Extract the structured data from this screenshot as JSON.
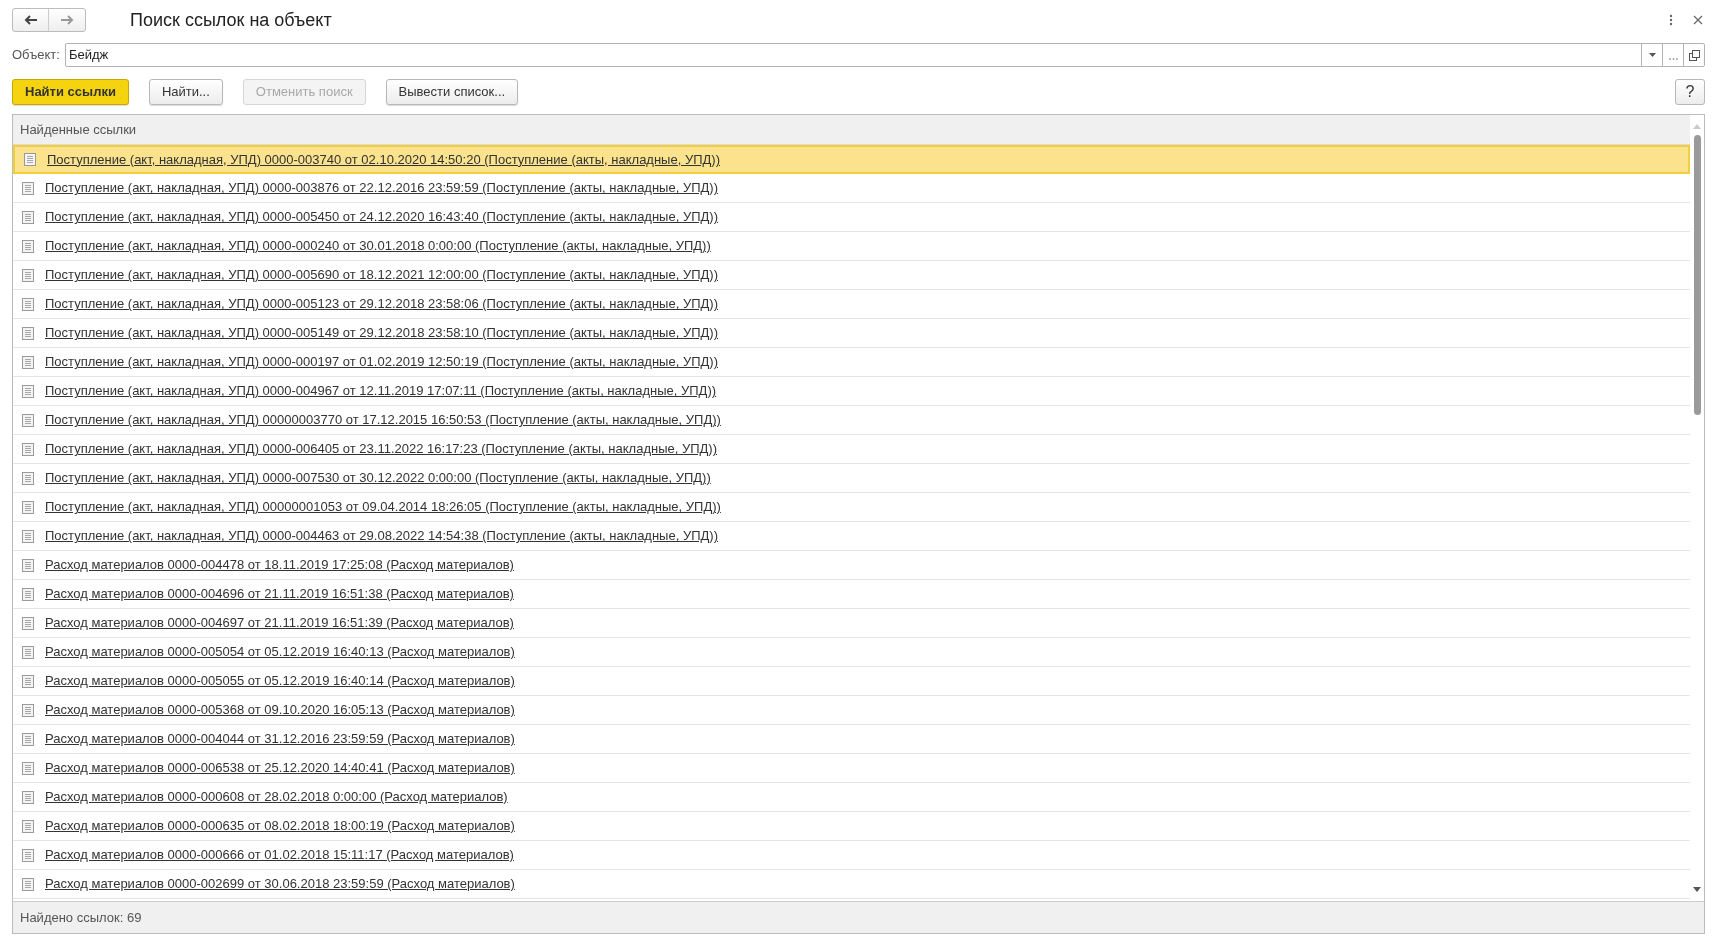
{
  "window": {
    "title": "Поиск ссылок на объект"
  },
  "object_field": {
    "label": "Объект:",
    "value": "Бейдж"
  },
  "buttons": [
    {
      "label": "Найти ссылки",
      "kind": "primary",
      "disabled": false
    },
    {
      "label": "Найти...",
      "kind": "default",
      "disabled": false
    },
    {
      "label": "Отменить поиск",
      "kind": "default",
      "disabled": true
    },
    {
      "label": "Вывести список...",
      "kind": "default",
      "disabled": false
    }
  ],
  "help_button": {
    "label": "?"
  },
  "table": {
    "header": "Найденные ссылки",
    "rows": [
      {
        "text": "Поступление (акт, накладная, УПД) 0000-003740 от 02.10.2020 14:50:20 (Поступление (акты, накладные, УПД))",
        "selected": true
      },
      {
        "text": "Поступление (акт, накладная, УПД) 0000-003876 от 22.12.2016 23:59:59 (Поступление (акты, накладные, УПД))",
        "selected": false
      },
      {
        "text": "Поступление (акт, накладная, УПД) 0000-005450 от 24.12.2020 16:43:40 (Поступление (акты, накладные, УПД))",
        "selected": false
      },
      {
        "text": "Поступление (акт, накладная, УПД) 0000-000240 от 30.01.2018 0:00:00 (Поступление (акты, накладные, УПД))",
        "selected": false
      },
      {
        "text": "Поступление (акт, накладная, УПД) 0000-005690 от 18.12.2021 12:00:00 (Поступление (акты, накладные, УПД))",
        "selected": false
      },
      {
        "text": "Поступление (акт, накладная, УПД) 0000-005123 от 29.12.2018 23:58:06 (Поступление (акты, накладные, УПД))",
        "selected": false
      },
      {
        "text": "Поступление (акт, накладная, УПД) 0000-005149 от 29.12.2018 23:58:10 (Поступление (акты, накладные, УПД))",
        "selected": false
      },
      {
        "text": "Поступление (акт, накладная, УПД) 0000-000197 от 01.02.2019 12:50:19 (Поступление (акты, накладные, УПД))",
        "selected": false
      },
      {
        "text": "Поступление (акт, накладная, УПД) 0000-004967 от 12.11.2019 17:07:11 (Поступление (акты, накладные, УПД))",
        "selected": false
      },
      {
        "text": "Поступление (акт, накладная, УПД) 00000003770 от 17.12.2015 16:50:53 (Поступление (акты, накладные, УПД))",
        "selected": false
      },
      {
        "text": "Поступление (акт, накладная, УПД) 0000-006405 от 23.11.2022 16:17:23 (Поступление (акты, накладные, УПД))",
        "selected": false
      },
      {
        "text": "Поступление (акт, накладная, УПД) 0000-007530 от 30.12.2022 0:00:00 (Поступление (акты, накладные, УПД))",
        "selected": false
      },
      {
        "text": "Поступление (акт, накладная, УПД) 00000001053 от 09.04.2014 18:26:05 (Поступление (акты, накладные, УПД))",
        "selected": false
      },
      {
        "text": "Поступление (акт, накладная, УПД) 0000-004463 от 29.08.2022 14:54:38 (Поступление (акты, накладные, УПД))",
        "selected": false
      },
      {
        "text": "Расход материалов 0000-004478 от 18.11.2019 17:25:08 (Расход материалов)",
        "selected": false
      },
      {
        "text": "Расход материалов 0000-004696 от 21.11.2019 16:51:38 (Расход материалов)",
        "selected": false
      },
      {
        "text": "Расход материалов 0000-004697 от 21.11.2019 16:51:39 (Расход материалов)",
        "selected": false
      },
      {
        "text": "Расход материалов 0000-005054 от 05.12.2019 16:40:13 (Расход материалов)",
        "selected": false
      },
      {
        "text": "Расход материалов 0000-005055 от 05.12.2019 16:40:14 (Расход материалов)",
        "selected": false
      },
      {
        "text": "Расход материалов 0000-005368 от 09.10.2020 16:05:13 (Расход материалов)",
        "selected": false
      },
      {
        "text": "Расход материалов 0000-004044 от 31.12.2016 23:59:59 (Расход материалов)",
        "selected": false
      },
      {
        "text": "Расход материалов 0000-006538 от 25.12.2020 14:40:41 (Расход материалов)",
        "selected": false
      },
      {
        "text": "Расход материалов 0000-000608 от 28.02.2018 0:00:00 (Расход материалов)",
        "selected": false
      },
      {
        "text": "Расход материалов 0000-000635 от 08.02.2018 18:00:19 (Расход материалов)",
        "selected": false
      },
      {
        "text": "Расход материалов 0000-000666 от 01.02.2018 15:11:17 (Расход материалов)",
        "selected": false
      },
      {
        "text": "Расход материалов 0000-002699 от 30.06.2018 23:59:59 (Расход материалов)",
        "selected": false
      }
    ],
    "footer": "Найдено ссылок: 69"
  }
}
